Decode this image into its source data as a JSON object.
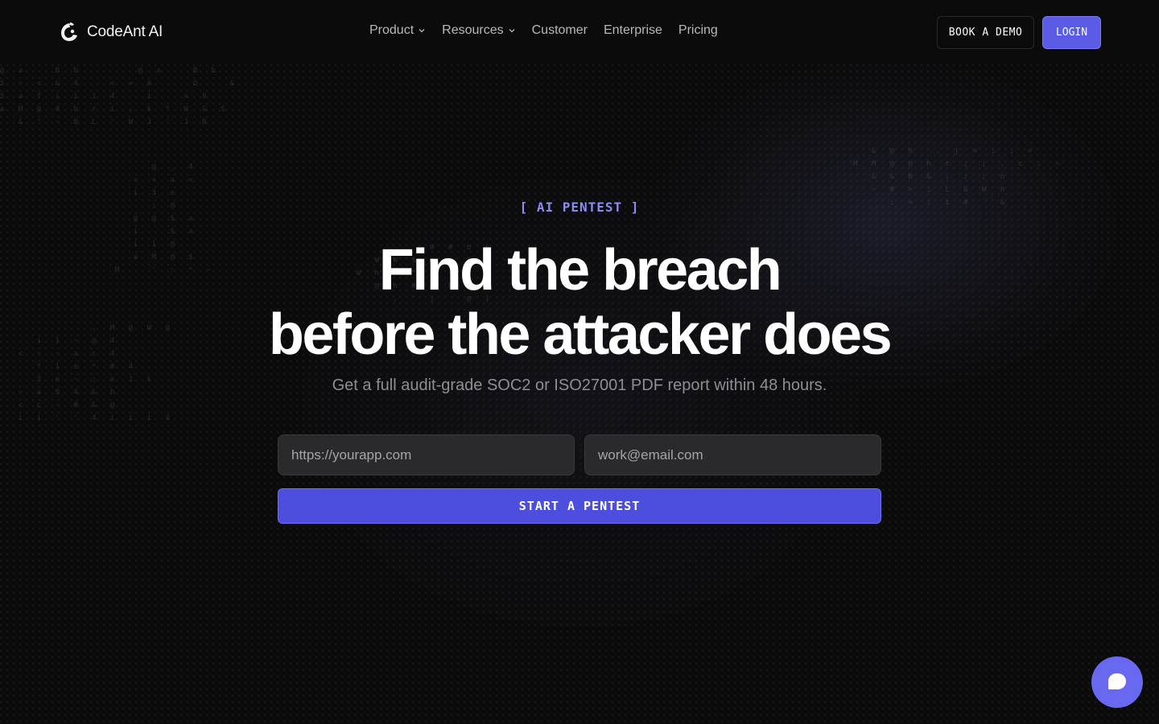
{
  "brand": {
    "name": "CodeAnt AI"
  },
  "nav": {
    "links": [
      {
        "label": "Product",
        "dropdown": true
      },
      {
        "label": "Resources",
        "dropdown": true
      },
      {
        "label": "Customer",
        "dropdown": false
      },
      {
        "label": "Enterprise",
        "dropdown": false
      },
      {
        "label": "Pricing",
        "dropdown": false
      }
    ],
    "demo_label": "BOOK A DEMO",
    "login_label": "LOGIN"
  },
  "hero": {
    "eyebrow": "[ AI PENTEST ]",
    "headline_line1": "Find the breach",
    "headline_line2": "before the attacker does",
    "subhead": "Get a full audit-grade SOC2 or ISO27001 PDF report within 48 hours.",
    "url_placeholder": "https://yourapp.com",
    "email_placeholder": "work@email.com",
    "cta_label": "START A PENTEST"
  },
  "colors": {
    "accent": "#5b5be6",
    "eyebrow": "#8c8cf4",
    "background": "#0b0b0c"
  },
  "icons": {
    "logo": "codeant-logo-icon",
    "dropdown": "chevron-down-icon",
    "chat": "chat-bubble-icon"
  }
}
